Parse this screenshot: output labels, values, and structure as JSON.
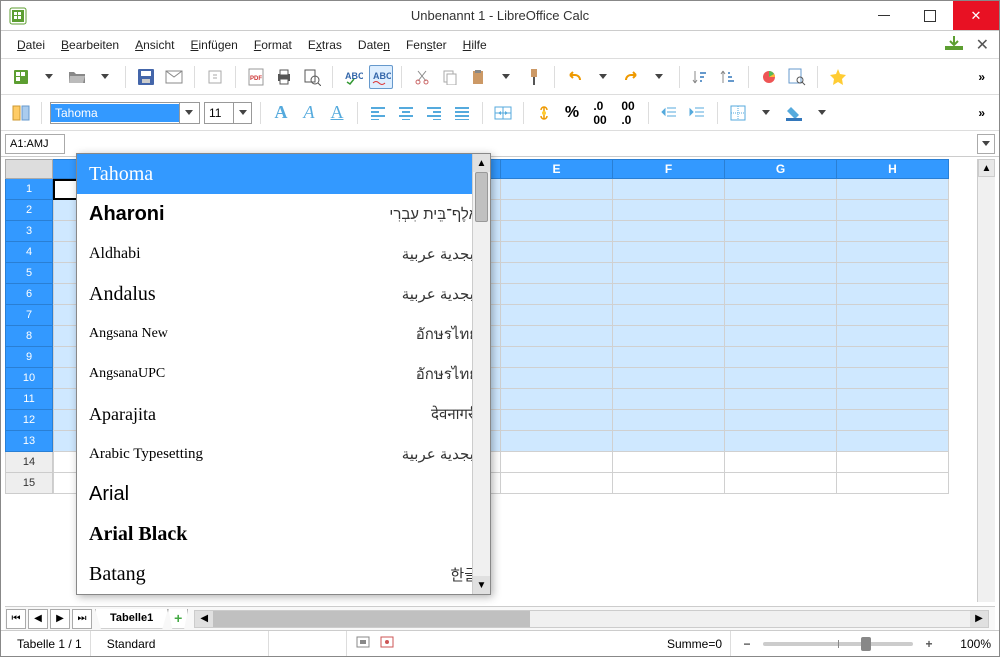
{
  "window": {
    "title": "Unbenannt 1 - LibreOffice Calc"
  },
  "menu": {
    "items": [
      "Datei",
      "Bearbeiten",
      "Ansicht",
      "Einfügen",
      "Format",
      "Extras",
      "Daten",
      "Fenster",
      "Hilfe"
    ]
  },
  "toolbar2": {
    "font_name": "Tahoma",
    "font_size": "11"
  },
  "namebox": "A1:AMJ",
  "columns": [
    "E",
    "F",
    "G",
    "H"
  ],
  "rows": [
    "1",
    "2",
    "3",
    "4",
    "5",
    "6",
    "7",
    "8",
    "9",
    "10",
    "11",
    "12",
    "13",
    "14",
    "15"
  ],
  "selected_row_count": 13,
  "font_dropdown": {
    "items": [
      {
        "name": "Tahoma",
        "sample": "",
        "selected": true,
        "style": "font-family:Tahoma;font-size:20px"
      },
      {
        "name": "Aharoni",
        "sample": "אָלֶף־בֵּית עִבְרִי",
        "style": "font-weight:900;font-size:20px"
      },
      {
        "name": "Aldhabi",
        "sample": "أبجدية عربية",
        "style": "font-family:serif;font-size:16px"
      },
      {
        "name": "Andalus",
        "sample": "أبجدية عربية",
        "style": "font-family:serif;font-size:20px"
      },
      {
        "name": "Angsana New",
        "sample": "อักษรไทย",
        "style": "font-family:serif;font-size:14px"
      },
      {
        "name": "AngsanaUPC",
        "sample": "อักษรไทย",
        "style": "font-family:serif;font-size:14px"
      },
      {
        "name": "Aparajita",
        "sample": "देवनागरी",
        "style": "font-family:serif;font-size:18px"
      },
      {
        "name": "Arabic Typesetting",
        "sample": "أبجدية عربية",
        "style": "font-family:serif;font-size:15px"
      },
      {
        "name": "Arial",
        "sample": "",
        "style": "font-family:Arial;font-size:20px"
      },
      {
        "name": "Arial Black",
        "sample": "",
        "style": "font-family:'Arial Black';font-weight:900;font-size:20px"
      },
      {
        "name": "Batang",
        "sample": "한글",
        "style": "font-family:serif;font-size:20px"
      }
    ]
  },
  "sheet_tab": "Tabelle1",
  "status": {
    "sheet_info": "Tabelle 1 / 1",
    "style": "Standard",
    "sum": "Summe=0",
    "zoom": "100%"
  }
}
